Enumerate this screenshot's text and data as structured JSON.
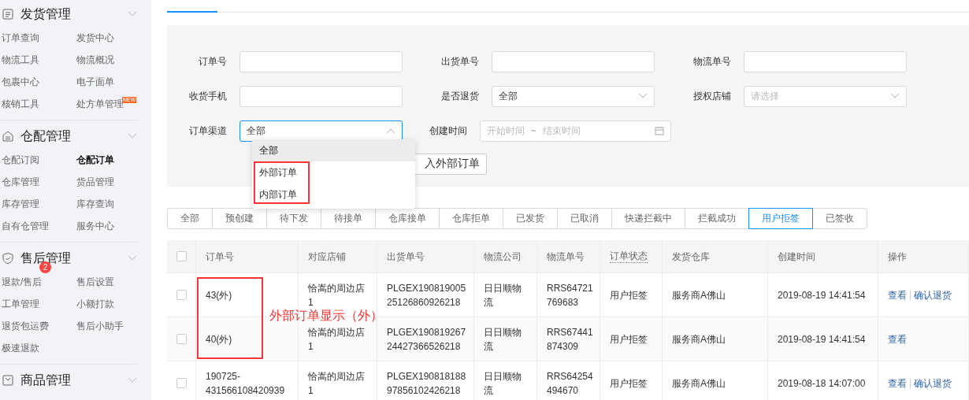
{
  "sidebar": {
    "groups": [
      {
        "title": "发货管理",
        "items": [
          {
            "label": "订单查询",
            "selected": false
          },
          {
            "label": "发货中心",
            "selected": false
          },
          {
            "label": "物流工具",
            "selected": false
          },
          {
            "label": "物流概况",
            "selected": false
          },
          {
            "label": "包裹中心",
            "selected": false
          },
          {
            "label": "电子面单",
            "selected": false
          },
          {
            "label": "核销工具",
            "selected": false
          },
          {
            "label": "处方单管理",
            "selected": false,
            "tag": "NEW"
          }
        ]
      },
      {
        "title": "仓配管理",
        "items": [
          {
            "label": "仓配订阅",
            "selected": false
          },
          {
            "label": "仓配订单",
            "selected": true
          },
          {
            "label": "仓库管理",
            "selected": false
          },
          {
            "label": "货品管理",
            "selected": false
          },
          {
            "label": "库存管理",
            "selected": false
          },
          {
            "label": "库存查询",
            "selected": false
          },
          {
            "label": "自有仓管理",
            "selected": false
          },
          {
            "label": "服务中心",
            "selected": false
          }
        ]
      },
      {
        "title": "售后管理",
        "items": [
          {
            "label": "退款/售后",
            "selected": false,
            "badge": "2"
          },
          {
            "label": "售后设置",
            "selected": false
          },
          {
            "label": "工单管理",
            "selected": false
          },
          {
            "label": "小额打款",
            "selected": false
          },
          {
            "label": "退货包运费",
            "selected": false
          },
          {
            "label": "售后小助手",
            "selected": false
          },
          {
            "label": "极速退款",
            "selected": false
          }
        ]
      },
      {
        "title": "商品管理"
      }
    ]
  },
  "filters": {
    "rows": [
      [
        {
          "label": "订单号",
          "kind": "text"
        },
        {
          "label": "出货单号",
          "kind": "text"
        },
        {
          "label": "物流单号",
          "kind": "text"
        }
      ],
      [
        {
          "label": "收货手机",
          "kind": "text"
        },
        {
          "label": "是否退货",
          "kind": "select",
          "value": "全部",
          "open": false
        },
        {
          "label": "授权店铺",
          "kind": "select",
          "placeholder": "请选择",
          "open": false
        }
      ],
      [
        {
          "label": "订单渠道",
          "kind": "select",
          "value": "全部",
          "open": true
        },
        {
          "label": "创建时间",
          "kind": "date",
          "placeholder": "开始时间",
          "end_placeholder": "结束时间",
          "separator": "~"
        }
      ]
    ],
    "dropdown": [
      {
        "label": "全部",
        "selected": true
      },
      {
        "label": "外部订单",
        "selected": false
      },
      {
        "label": "内部订单",
        "selected": false
      }
    ],
    "button": "入外部订单"
  },
  "status_tabs": [
    {
      "label": "全部",
      "selected": false
    },
    {
      "label": "预创建",
      "selected": false
    },
    {
      "label": "待下发",
      "selected": false
    },
    {
      "label": "待接单",
      "selected": false
    },
    {
      "label": "仓库接单",
      "selected": false
    },
    {
      "label": "仓库拒单",
      "selected": false
    },
    {
      "label": "已发货",
      "selected": false
    },
    {
      "label": "已取消",
      "selected": false
    },
    {
      "label": "快递拦截中",
      "selected": false
    },
    {
      "label": "拦截成功",
      "selected": false
    },
    {
      "label": "用户拒签",
      "selected": true
    },
    {
      "label": "已签收",
      "selected": false
    }
  ],
  "table": {
    "select_all": {
      "checked": false
    },
    "columns": [
      {
        "label": "订单号",
        "hint": false
      },
      {
        "label": "对应店铺",
        "hint": false
      },
      {
        "label": "出货单号",
        "hint": false
      },
      {
        "label": "物流公司",
        "hint": false
      },
      {
        "label": "物流单号",
        "hint": false
      },
      {
        "label": "订单状态",
        "hint": true
      },
      {
        "label": "发货仓库",
        "hint": false
      },
      {
        "label": "创建时间",
        "hint": false
      },
      {
        "label": "操作",
        "hint": false
      }
    ],
    "rows": [
      {
        "checked": false,
        "cells": [
          "43(外)",
          "恰嵩的周边店1",
          "PLGEX19081900525126860926218",
          "日日顺物流",
          "RRS64721769683",
          "用户拒签",
          "服务商A佛山",
          "2019-08-19 14:41:54"
        ],
        "actions": [
          "查看",
          "确认退货"
        ]
      },
      {
        "checked": false,
        "cells": [
          "40(外)",
          "恰嵩的周边店1",
          "PLGEX19081926724427366526218",
          "日日顺物流",
          "RRS67441874309",
          "用户拒签",
          "服务商A佛山",
          "2019-08-19 14:41:54"
        ],
        "actions": [
          "查看"
        ]
      },
      {
        "checked": false,
        "cells": [
          "190725-431566108420939",
          "恰嵩的周边店1",
          "PLGEX19081818897856102426218",
          "日日顺物流",
          "RRS64254494670",
          "用户拒签",
          "服务商A佛山",
          "2019-08-18 14:07:00"
        ],
        "actions": [
          "查看",
          "确认退货"
        ]
      }
    ]
  },
  "annotation": {
    "note": "外部订单显示（外）"
  }
}
